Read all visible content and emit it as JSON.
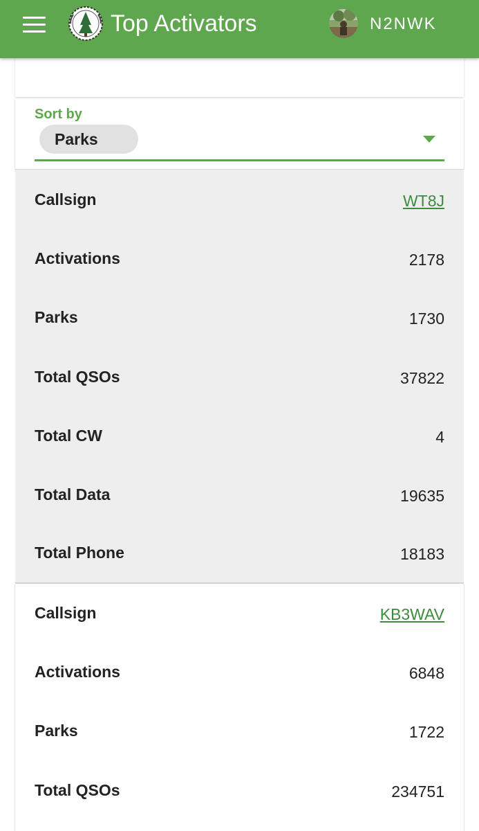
{
  "header": {
    "title": "Top Activators",
    "user": "N2NWK",
    "icons": [
      "menu-icon",
      "pota-logo",
      "user-avatar"
    ],
    "color": "#5fa74e"
  },
  "sort": {
    "label": "Sort by",
    "selected": "Parks"
  },
  "records": [
    {
      "rows": [
        {
          "label": "Callsign",
          "value": "WT8J"
        },
        {
          "label": "Activations",
          "value": "2178"
        },
        {
          "label": "Parks",
          "value": "1730"
        },
        {
          "label": "Total QSOs",
          "value": "37822"
        },
        {
          "label": "Total CW",
          "value": "4"
        },
        {
          "label": "Total Data",
          "value": "19635"
        },
        {
          "label": "Total Phone",
          "value": "18183"
        }
      ]
    },
    {
      "rows": [
        {
          "label": "Callsign",
          "value": "KB3WAV"
        },
        {
          "label": "Activations",
          "value": "6848"
        },
        {
          "label": "Parks",
          "value": "1722"
        },
        {
          "label": "Total QSOs",
          "value": "234751"
        }
      ]
    }
  ]
}
